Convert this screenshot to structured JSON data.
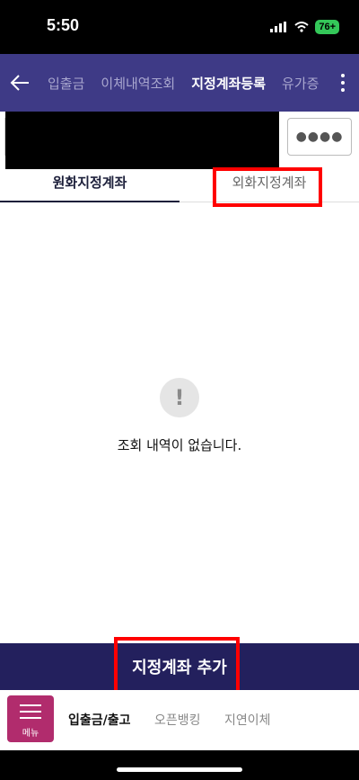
{
  "status_bar": {
    "time": "5:50",
    "battery": "76+"
  },
  "nav": {
    "tabs": [
      {
        "label": "입출금"
      },
      {
        "label": "이체내역조회"
      },
      {
        "label": "지정계좌등록"
      },
      {
        "label": "유가증"
      }
    ]
  },
  "account": {
    "password_mask": "●●●●"
  },
  "subtabs": {
    "left": "원화지정계좌",
    "right": "외화지정계좌"
  },
  "empty": {
    "icon": "!",
    "message": "조회 내역이 없습니다."
  },
  "add_button": "지정계좌 추가",
  "bottom": {
    "menu_label": "메뉴",
    "items": [
      {
        "label": "입출금/출고"
      },
      {
        "label": "오픈뱅킹"
      },
      {
        "label": "지연이체"
      }
    ]
  },
  "colors": {
    "nav_bg": "#3e3a86",
    "add_bg": "#23205d",
    "menu_bg": "#b12c6d",
    "highlight": "#ff0000"
  }
}
